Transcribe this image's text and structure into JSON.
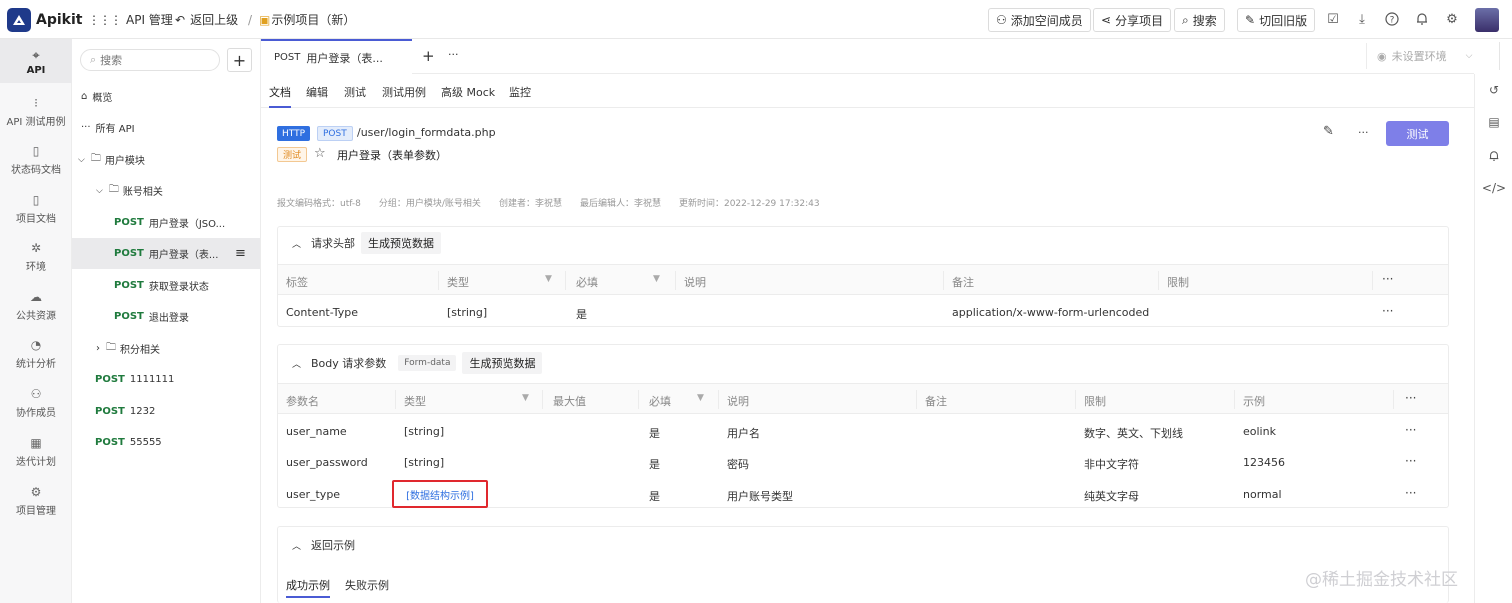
{
  "app": {
    "name": "Apikit"
  },
  "topbar": {
    "api_manage": "API 管理",
    "back": "返回上级",
    "separator": "/",
    "project": "示例项目（新）",
    "add_member": "添加空间成员",
    "share": "分享项目",
    "search": "搜索",
    "switch_old": "切回旧版"
  },
  "rail": {
    "items": [
      {
        "label": "API",
        "icon": "api-icon"
      },
      {
        "label": "API 测试用例",
        "icon": "test-case-icon"
      },
      {
        "label": "状态码文档",
        "icon": "status-doc-icon"
      },
      {
        "label": "项目文档",
        "icon": "project-doc-icon"
      },
      {
        "label": "环境",
        "icon": "environment-icon"
      },
      {
        "label": "公共资源",
        "icon": "public-resource-icon"
      },
      {
        "label": "统计分析",
        "icon": "stats-icon"
      },
      {
        "label": "协作成员",
        "icon": "members-icon"
      },
      {
        "label": "迭代计划",
        "icon": "iteration-icon"
      },
      {
        "label": "项目管理",
        "icon": "project-manage-icon"
      }
    ]
  },
  "tree": {
    "search_placeholder": "搜索",
    "overview": "概览",
    "all_api": "所有 API",
    "user_module": "用户模块",
    "account": "账号相关",
    "account_items": [
      {
        "method": "POST",
        "name": "用户登录（JSO..."
      },
      {
        "method": "POST",
        "name": "用户登录（表..."
      },
      {
        "method": "POST",
        "name": "获取登录状态"
      },
      {
        "method": "POST",
        "name": "退出登录"
      }
    ],
    "points": "积分相关",
    "root_items": [
      {
        "method": "POST",
        "name": "1111111"
      },
      {
        "method": "POST",
        "name": "1232"
      },
      {
        "method": "POST",
        "name": "55555"
      }
    ]
  },
  "tabs": {
    "active_method": "POST",
    "active_title": "用户登录（表...",
    "add": "+",
    "more": "···",
    "env_placeholder": "未设置环境"
  },
  "subtabs": [
    "文档",
    "编辑",
    "测试",
    "测试用例",
    "高级 Mock",
    "监控"
  ],
  "api": {
    "protocol": "HTTP",
    "method": "POST",
    "path": "/user/login_formdata.php",
    "status": "测试",
    "name": "用户登录（表单参数）",
    "test_button": "测试",
    "meta": {
      "encoding": "报文编码格式：utf-8",
      "group": "分组：用户模块/账号相关",
      "creator": "创建者：李祝慧",
      "last_editor": "最后编辑人：李祝慧",
      "updated": "更新时间：2022-12-29 17:32:43"
    }
  },
  "headers_section": {
    "title": "请求头部",
    "gen_button": "生成预览数据",
    "columns": [
      "标签",
      "类型",
      "必填",
      "说明",
      "备注",
      "限制"
    ],
    "rows": [
      {
        "tag": "Content-Type",
        "type": "[string]",
        "required": "是",
        "desc": "",
        "note": "application/x-www-form-urlencoded",
        "limit": ""
      }
    ]
  },
  "body_section": {
    "title": "Body 请求参数",
    "format": "Form-data",
    "gen_button": "生成预览数据",
    "columns": [
      "参数名",
      "类型",
      "最大值",
      "必填",
      "说明",
      "备注",
      "限制",
      "示例"
    ],
    "rows": [
      {
        "name": "user_name",
        "type": "[string]",
        "max": "",
        "required": "是",
        "desc": "用户名",
        "note": "",
        "limit": "数字、英文、下划线",
        "example": "eolink"
      },
      {
        "name": "user_password",
        "type": "[string]",
        "max": "",
        "required": "是",
        "desc": "密码",
        "note": "",
        "limit": "非中文字符",
        "example": "123456"
      },
      {
        "name": "user_type",
        "type": "[数据结构示例]",
        "max": "",
        "required": "是",
        "desc": "用户账号类型",
        "note": "",
        "limit": "纯英文字母",
        "example": "normal"
      }
    ]
  },
  "response_section": {
    "title": "返回示例",
    "tabs": [
      "成功示例",
      "失败示例"
    ]
  },
  "watermark": "@稀土掘金技术社区",
  "colors": {
    "accent": "#4a5bd4",
    "post_green": "#1f7a3d",
    "highlight_red": "#e0282e",
    "link_blue": "#2f6fe0"
  }
}
